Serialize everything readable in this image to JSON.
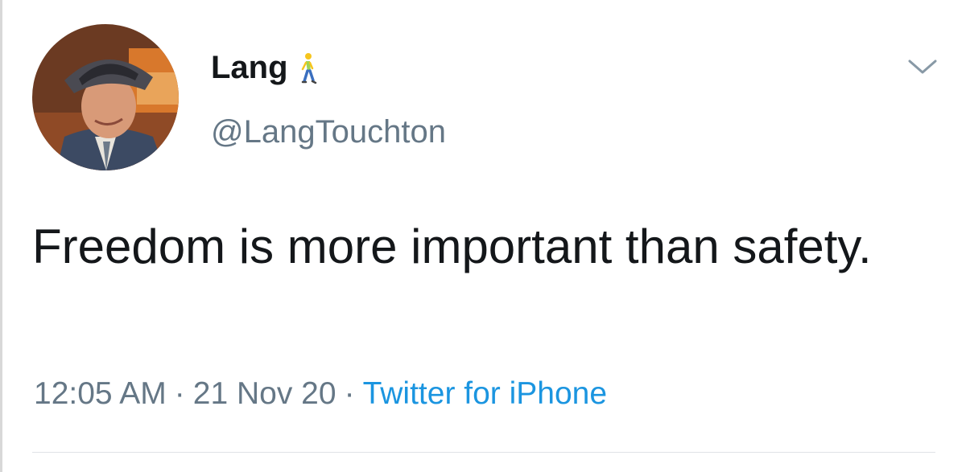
{
  "tweet": {
    "author": {
      "display_name": "Lang",
      "handle": "@LangTouchton",
      "name_emoji": "person-walking-emoji"
    },
    "text": "Freedom is more important than safety.",
    "time": "12:05 AM",
    "date": "21 Nov 20",
    "separator": "·",
    "source": "Twitter for iPhone",
    "menu_icon": "chevron-down-icon"
  },
  "colors": {
    "text_primary": "#14171a",
    "text_secondary": "#657786",
    "link": "#1b95e0",
    "divider": "#dfe3e6"
  }
}
